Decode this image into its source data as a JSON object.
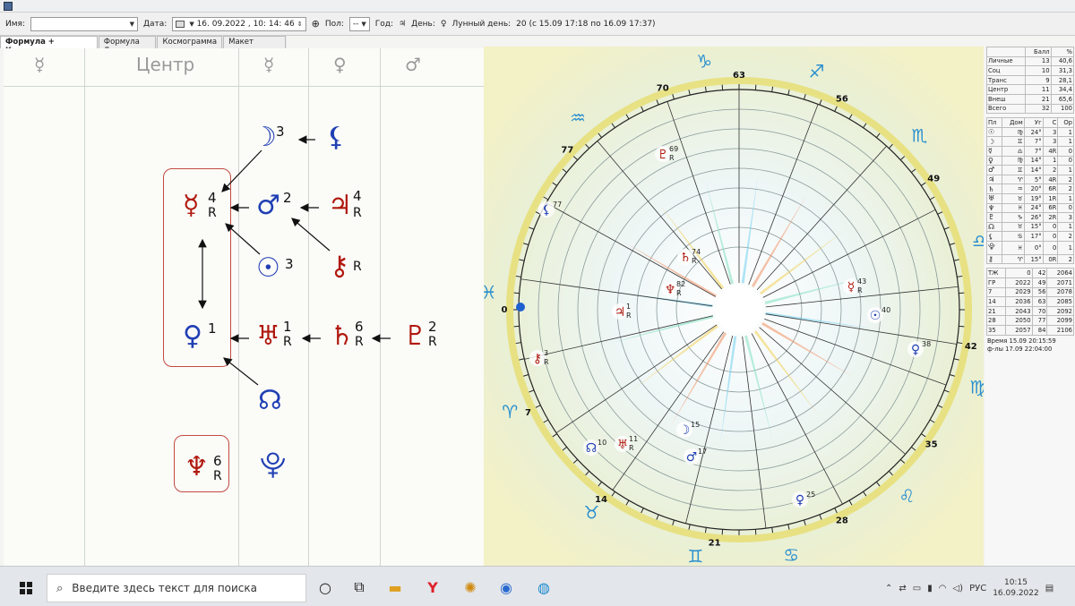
{
  "toolbar": {
    "name_label": "Имя:",
    "date_label": "Дата:",
    "date_value": "16. 09.2022",
    "time_value": ", 10: 14: 46",
    "gender_label": "Пол:",
    "gender_value": "--",
    "year_label": "Год:",
    "year_glyph": "♃",
    "day_label": "День:",
    "day_glyph": "♀",
    "moon_day_label": "Лунный день:",
    "moon_day_value": "20 (с 15.09 17:18 по 16.09 17:37)"
  },
  "tabs": [
    "Формула + Космограмма",
    "Формула Души",
    "Космограмма",
    "Макет страницы"
  ],
  "formula": {
    "headers": {
      "col1": "☿",
      "col2": "Центр",
      "col3": "☿",
      "col4": "♀",
      "col5": "♂"
    },
    "items": [
      {
        "glyph": "☽",
        "num": "3",
        "r": "",
        "color": "blue"
      },
      {
        "glyph": "⚸",
        "num": "",
        "r": "",
        "color": "blue"
      },
      {
        "glyph": "☿",
        "num": "4",
        "r": "R",
        "color": "red"
      },
      {
        "glyph": "♂",
        "num": "2",
        "r": "",
        "color": "blue"
      },
      {
        "glyph": "♃",
        "num": "4",
        "r": "R",
        "color": "red"
      },
      {
        "glyph": "☉",
        "num": "3",
        "r": "",
        "color": "blue"
      },
      {
        "glyph": "⚷",
        "num": "",
        "r": "R",
        "color": "red"
      },
      {
        "glyph": "♀",
        "num": "1",
        "r": "",
        "color": "blue"
      },
      {
        "glyph": "♅",
        "num": "1",
        "r": "R",
        "color": "red"
      },
      {
        "glyph": "♄",
        "num": "6",
        "r": "R",
        "color": "red"
      },
      {
        "glyph": "♇",
        "num": "2",
        "r": "R",
        "color": "red"
      },
      {
        "glyph": "☊",
        "num": "",
        "r": "",
        "color": "blue"
      },
      {
        "glyph": "♆",
        "num": "6",
        "r": "R",
        "color": "red"
      },
      {
        "glyph": "⯓",
        "num": "",
        "r": "",
        "color": "blue"
      }
    ]
  },
  "chart": {
    "signs": {
      "capricorn": "♑",
      "sagittarius": "♐",
      "scorpio": "♏",
      "libra": "♎",
      "virgo": "♍",
      "leo": "♌",
      "cancer": "♋",
      "gemini": "♊",
      "taurus": "♉",
      "aries": "♈",
      "pisces": "♓",
      "aquarius": "♒"
    },
    "degrees": [
      "63",
      "70",
      "56",
      "77",
      "49",
      "0",
      "42",
      "7",
      "35",
      "14",
      "28",
      "21"
    ],
    "planets": [
      {
        "glyph": "♇",
        "num": "69",
        "r": "R",
        "color": "#b0180e"
      },
      {
        "glyph": "⚸",
        "num": "77",
        "r": "",
        "color": "#1f3fb4"
      },
      {
        "glyph": "♄",
        "num": "74",
        "r": "R",
        "color": "#b0180e"
      },
      {
        "glyph": "♆",
        "num": "82",
        "r": "R",
        "color": "#b0180e"
      },
      {
        "glyph": "♃",
        "num": "1",
        "r": "R",
        "color": "#b0180e"
      },
      {
        "glyph": "⚷",
        "num": "3",
        "r": "R",
        "color": "#b0180e"
      },
      {
        "glyph": "☊",
        "num": "10",
        "r": "",
        "color": "#1f3fb4"
      },
      {
        "glyph": "♅",
        "num": "11",
        "r": "R",
        "color": "#b0180e"
      },
      {
        "glyph": "☽",
        "num": "15",
        "r": "",
        "color": "#1f3fb4"
      },
      {
        "glyph": "♂",
        "num": "17",
        "r": "",
        "color": "#1f3fb4"
      },
      {
        "glyph": "♀",
        "num": "25",
        "r": "",
        "color": "#1f3fb4"
      },
      {
        "glyph": "♀",
        "num": "38",
        "r": "",
        "color": "#1f3fb4"
      },
      {
        "glyph": "☉",
        "num": "40",
        "r": "",
        "color": "#1f3fb4"
      },
      {
        "glyph": "☿",
        "num": "43",
        "r": "R",
        "color": "#b0180e"
      }
    ]
  },
  "stats": {
    "head": [
      "",
      "Балл",
      "%"
    ],
    "rows": [
      [
        "Личные",
        "13",
        "40,6"
      ],
      [
        "Соц",
        "10",
        "31,3"
      ],
      [
        "Транс",
        "9",
        "28,1"
      ],
      [
        "Центр",
        "11",
        "34,4"
      ],
      [
        "Внеш",
        "21",
        "65,6"
      ],
      [
        "Всего",
        "32",
        "100"
      ]
    ],
    "planet_head": [
      "Пл",
      "Дом",
      "Уг",
      "С",
      "Ор"
    ],
    "planets": [
      [
        "☉",
        "♍",
        "24°",
        "3",
        "1"
      ],
      [
        "☽",
        "♊",
        "7°",
        "3",
        "1"
      ],
      [
        "☿",
        "♎",
        "7°",
        "4R",
        "0"
      ],
      [
        "♀",
        "♍",
        "14°",
        "1",
        "0"
      ],
      [
        "♂",
        "♊",
        "14°",
        "2",
        "1"
      ],
      [
        "♃",
        "♈",
        "5°",
        "4R",
        "2"
      ],
      [
        "♄",
        "♒",
        "20°",
        "6R",
        "2"
      ],
      [
        "♅",
        "♉",
        "19°",
        "1R",
        "1"
      ],
      [
        "♆",
        "♓",
        "24°",
        "6R",
        "0"
      ],
      [
        "♇",
        "♑",
        "26°",
        "2R",
        "3"
      ],
      [
        "☊",
        "♉",
        "15°",
        "0",
        "1"
      ],
      [
        "⚸",
        "♋",
        "17°",
        "0",
        "2"
      ],
      [
        "⯓",
        "♓",
        "0°",
        "0",
        "1"
      ],
      [
        "⚷",
        "♈",
        "15°",
        "0R",
        "2"
      ]
    ],
    "years_head": [
      "ТЖ",
      "0",
      "42",
      "2064"
    ],
    "years": [
      [
        "ГР",
        "2022",
        "49",
        "2071"
      ],
      [
        "7",
        "2029",
        "56",
        "2078"
      ],
      [
        "14",
        "2036",
        "63",
        "2085"
      ],
      [
        "21",
        "2043",
        "70",
        "2092"
      ],
      [
        "28",
        "2050",
        "77",
        "2099"
      ],
      [
        "35",
        "2057",
        "84",
        "2106"
      ]
    ],
    "time1": "Время 15.09 20:15:59",
    "time2": "ф-лы 17.09 22:04:00"
  },
  "taskbar": {
    "search_placeholder": "Введите здесь текст для поиска",
    "lang": "РУС",
    "time": "10:15",
    "date": "16.09.2022"
  },
  "colors": {
    "blue": "#1f3fb4",
    "red": "#b0180e"
  }
}
